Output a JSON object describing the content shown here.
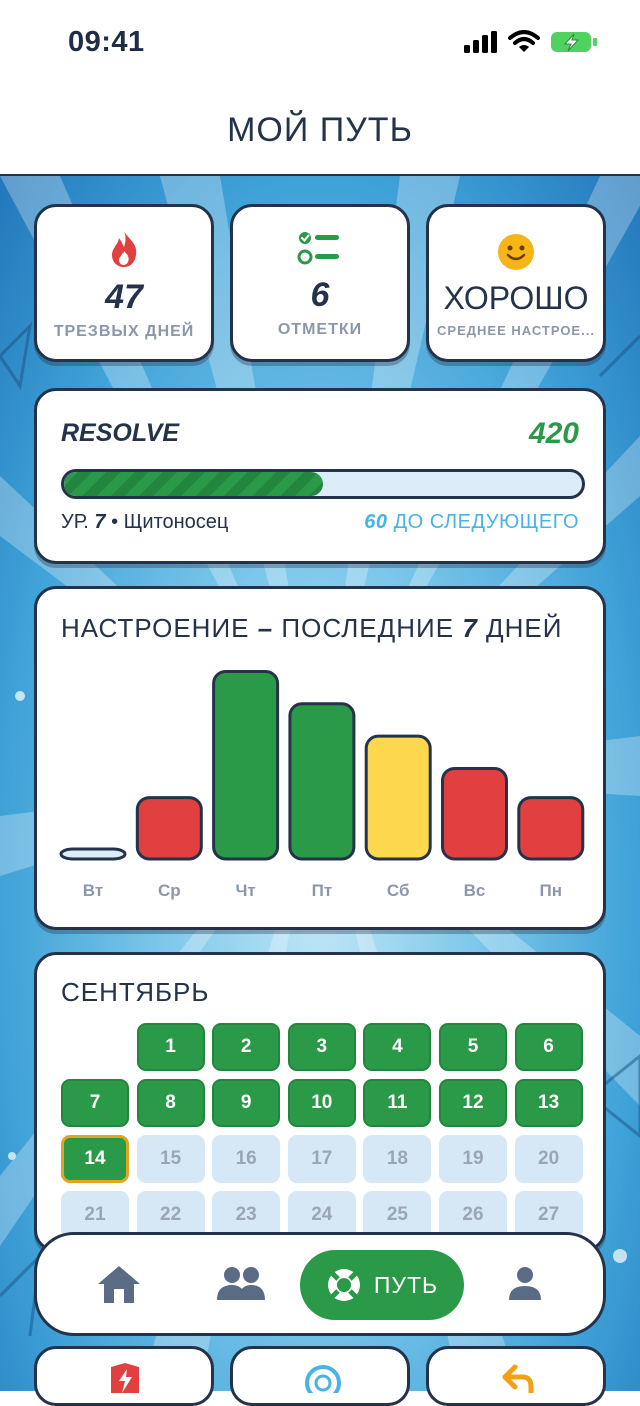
{
  "status": {
    "time": "09:41"
  },
  "header": {
    "title": "МОЙ ПУТЬ"
  },
  "stats": [
    {
      "icon": "fire-icon",
      "value": "47",
      "label": "ТРЕЗВЫХ ДНЕЙ"
    },
    {
      "icon": "checklist-icon",
      "value": "6",
      "label": "ОТМЕТКИ"
    },
    {
      "icon": "smiley-icon",
      "value": "ХОРОШО",
      "label": "СРЕДНЕЕ НАСТРОЕ..."
    }
  ],
  "resolve": {
    "title": "RESOLVE",
    "points": "420",
    "progress": 0.5,
    "level_prefix": "УР.",
    "level_num": "7",
    "level_title": "Щитоносец",
    "next_num": "60",
    "next_label": "ДО СЛЕДУЮЩЕГО"
  },
  "mood": {
    "title_a": "НАСТРОЕНИЕ",
    "title_dash": "–",
    "title_b": "ПОСЛЕДНИЕ",
    "title_num": "7",
    "title_c": "ДНЕЙ"
  },
  "chart_data": {
    "type": "bar",
    "categories": [
      "Вт",
      "Ср",
      "Чт",
      "Пт",
      "Сб",
      "Вс",
      "Пн"
    ],
    "values": [
      0.25,
      1.9,
      5.8,
      4.8,
      3.8,
      2.8,
      1.9
    ],
    "colors": [
      "#dcecf8",
      "#e24040",
      "#2a9a48",
      "#2a9a48",
      "#fdd74d",
      "#e24040",
      "#e24040"
    ],
    "ylim": [
      0,
      6
    ]
  },
  "calendar": {
    "month": "СЕНТЯБРЬ",
    "start_col": 1,
    "today": "14",
    "days_done": [
      "1",
      "2",
      "3",
      "4",
      "5",
      "6",
      "7",
      "8",
      "9",
      "10",
      "11",
      "12",
      "13"
    ],
    "days_future": [
      "15",
      "16",
      "17",
      "18",
      "19",
      "20",
      "21",
      "22",
      "23",
      "24",
      "25",
      "26",
      "27"
    ]
  },
  "nav": {
    "items": [
      {
        "icon": "home-icon"
      },
      {
        "icon": "community-icon"
      },
      {
        "icon": "lifebuoy-icon",
        "label": "ПУТЬ",
        "active": true
      },
      {
        "icon": "profile-icon"
      }
    ]
  },
  "colors": {
    "accent": "#2a9a48",
    "ink": "#243349",
    "link": "#46b4e6",
    "warn": "#e24040",
    "mood_ok": "#fdd74d"
  }
}
